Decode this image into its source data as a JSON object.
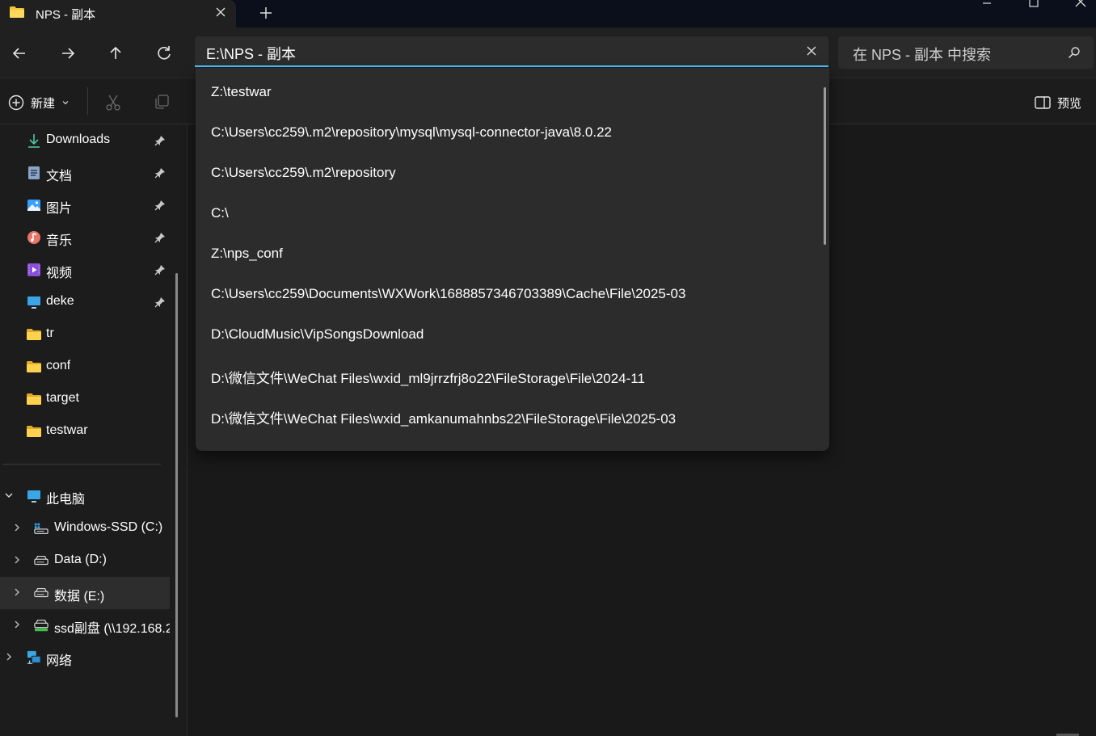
{
  "window": {
    "tab_title": "NPS - 副本"
  },
  "navigation": {
    "address_value": "E:\\NPS - 副本",
    "search_placeholder": "在 NPS - 副本 中搜索"
  },
  "toolbar": {
    "new_label": "新建",
    "preview_label": "预览"
  },
  "sidebar": {
    "quick_access": [
      {
        "label": "Downloads",
        "icon": "downloads-icon"
      },
      {
        "label": "文档",
        "icon": "documents-icon"
      },
      {
        "label": "图片",
        "icon": "pictures-icon"
      },
      {
        "label": "音乐",
        "icon": "music-icon"
      },
      {
        "label": "视频",
        "icon": "videos-icon"
      },
      {
        "label": "deke",
        "icon": "desktop-icon"
      },
      {
        "label": "tr",
        "icon": "folder-icon"
      },
      {
        "label": "conf",
        "icon": "folder-icon"
      },
      {
        "label": "target",
        "icon": "folder-icon"
      },
      {
        "label": "testwar",
        "icon": "folder-icon"
      }
    ],
    "this_pc": "此电脑",
    "drives": [
      {
        "label": "Windows-SSD (C:)",
        "icon": "system-drive-icon"
      },
      {
        "label": "Data (D:)",
        "icon": "drive-icon"
      },
      {
        "label": "数据 (E:)",
        "icon": "drive-icon"
      },
      {
        "label": "ssd副盘 (\\\\192.168.2",
        "icon": "network-drive-icon"
      }
    ],
    "network": "网络",
    "selected": "数据 (E:)"
  },
  "address_history": [
    "Z:\\testwar",
    "C:\\Users\\cc259\\.m2\\repository\\mysql\\mysql-connector-java\\8.0.22",
    "C:\\Users\\cc259\\.m2\\repository",
    "C:\\",
    "Z:\\nps_conf",
    "C:\\Users\\cc259\\Documents\\WXWork\\1688857346703389\\Cache\\File\\2025-03",
    "D:\\CloudMusic\\VipSongsDownload",
    "D:\\微信文件\\WeChat Files\\wxid_ml9jrrzfrj8o22\\FileStorage\\File\\2024-11",
    "D:\\微信文件\\WeChat Files\\wxid_amkanumahnbs22\\FileStorage\\File\\2025-03"
  ],
  "colors": {
    "accent": "#4cc2ff",
    "folder": "#f4c33a",
    "background": "#191919"
  }
}
